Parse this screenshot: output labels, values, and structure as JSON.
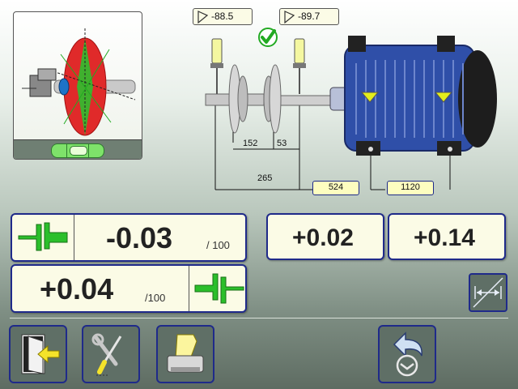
{
  "angles": {
    "left": "-88.5",
    "right": "-89.7"
  },
  "status": {
    "ok_icon": "checkmark-icon",
    "ok_color": "#22aa22"
  },
  "dimensions": {
    "d1": "152",
    "d2": "53",
    "d3": "265",
    "d4": "524",
    "d5": "1120"
  },
  "measurements": {
    "vertical_angular": {
      "value": "-0.03",
      "unit": "/ 100",
      "icon": "vertical-coupling-icon"
    },
    "vertical_offset": {
      "value": "+0.02"
    },
    "vertical_foot": {
      "value": "+0.14"
    },
    "horizontal_angular": {
      "value": "+0.04",
      "unit": "/100",
      "icon": "horizontal-coupling-icon"
    }
  },
  "toolbar": {
    "exit_icon": "exit-door-icon",
    "settings_icon": "tools-icon",
    "report_icon": "printer-icon",
    "back_icon": "undo-arrow-icon"
  },
  "colors": {
    "accent": "#1f2a8a",
    "panel_bg": "#fbfbe6",
    "coupling_green": "#2bbf2b",
    "motor_blue": "#2f4fa8",
    "dim_box": "#fdfdc0"
  }
}
